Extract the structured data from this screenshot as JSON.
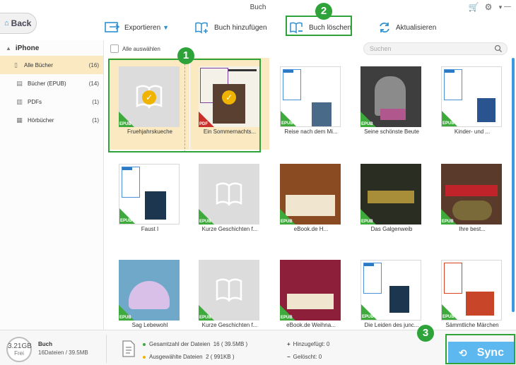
{
  "window": {
    "title": "Buch"
  },
  "nav": {
    "back_label": "Back"
  },
  "toolbar": {
    "export_label": "Exportieren",
    "add_label": "Buch hinzufügen",
    "delete_label": "Buch löschen",
    "refresh_label": "Aktualisieren"
  },
  "annotations": {
    "badge1": "1",
    "badge2": "2",
    "badge3": "3",
    "color": "#2ea33a"
  },
  "sidebar": {
    "device": "iPhone",
    "items": [
      {
        "label": "Alle Bücher",
        "count": "(16)",
        "icon": "book-open-icon"
      },
      {
        "label": "Bücher (EPUB)",
        "count": "(14)",
        "icon": "book-icon"
      },
      {
        "label": "PDFs",
        "count": "(1)",
        "icon": "pdf-icon"
      },
      {
        "label": "Hörbücher",
        "count": "(1)",
        "icon": "audiobook-icon"
      }
    ]
  },
  "list": {
    "select_all_label": "Alle auswählen",
    "search_placeholder": "Suchen"
  },
  "books": [
    {
      "title": "Fruehjahrskueche",
      "tag": "EPUB",
      "selected": true
    },
    {
      "title": "Ein Sommernachts...",
      "tag": "PDF",
      "selected": true
    },
    {
      "title": "Reise nach dem Mi...",
      "tag": "EPUB",
      "selected": false
    },
    {
      "title": "Seine schönste Beute",
      "tag": "EPUB",
      "selected": false
    },
    {
      "title": "Kinder- und ...",
      "tag": "EPUB",
      "selected": false
    },
    {
      "title": "Faust I",
      "tag": "EPUB",
      "selected": false
    },
    {
      "title": "Kurze Geschichten f...",
      "tag": "EPUB",
      "selected": false
    },
    {
      "title": "eBook.de H...",
      "tag": "EPUB",
      "selected": false
    },
    {
      "title": "Das Galgenweib",
      "tag": "EPUB",
      "selected": false
    },
    {
      "title": "Ihre best...",
      "tag": "EPUB",
      "selected": false
    },
    {
      "title": "Sag Lebewohl",
      "tag": "EPUB",
      "selected": false
    },
    {
      "title": "Kurze Geschichten f...",
      "tag": "EPUB",
      "selected": false
    },
    {
      "title": "eBook.de Weihna...",
      "tag": "EPUB",
      "selected": false
    },
    {
      "title": "Die Leiden des junc...",
      "tag": "EPUB",
      "selected": false
    },
    {
      "title": "Sämmtliche Märchen",
      "tag": "EPUB",
      "selected": false
    }
  ],
  "status": {
    "free_space": "3.21GB",
    "free_label": "Frei",
    "device_label": "Buch",
    "device_info": "16Dateien / 39.5MB",
    "total_label": "Gesamtzahl der Dateien",
    "total_value": "16 ( 39.5MB )",
    "selected_label": "Ausgewählte Dateien",
    "selected_value": "2 ( 991KB )",
    "added_label": "Hinzugefügt: 0",
    "deleted_label": "Gelöscht: 0",
    "sync_label": "Sync"
  }
}
